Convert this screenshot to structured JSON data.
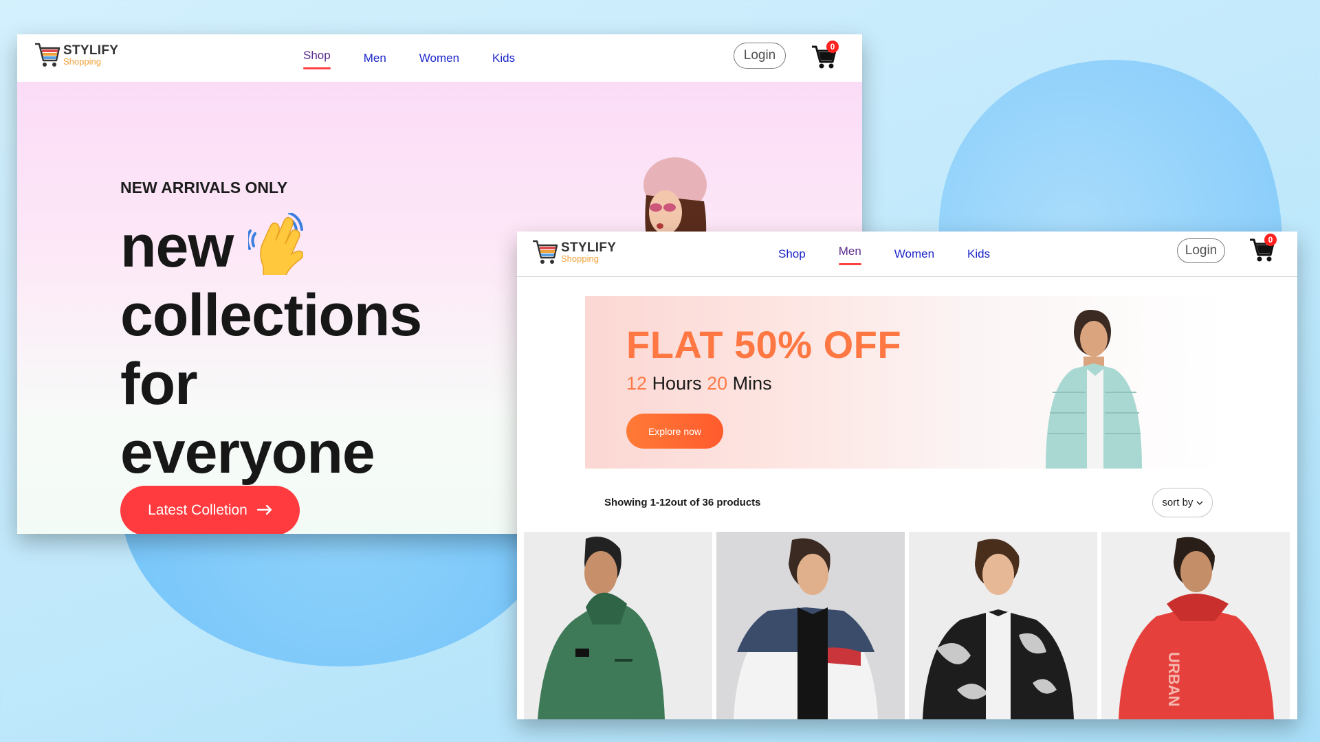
{
  "colors": {
    "accent_red": "#ff3b3f",
    "nav_link": "#1b25c9",
    "nav_active": "#5b2c8c",
    "offer_orange": "#ff7742"
  },
  "brand": {
    "name": "STYLIFY",
    "tagline": "Shopping",
    "logo_icon": "shopping-cart-icon"
  },
  "screen1": {
    "nav": {
      "items": [
        {
          "label": "Shop",
          "active": true
        },
        {
          "label": "Men",
          "active": false
        },
        {
          "label": "Women",
          "active": false
        },
        {
          "label": "Kids",
          "active": false
        }
      ],
      "login_label": "Login",
      "cart_count": "0"
    },
    "hero": {
      "eyebrow": "NEW ARRIVALS ONLY",
      "title_lines": [
        "new",
        "collections",
        "for",
        "everyone"
      ],
      "wave_icon": "waving-hand-icon",
      "cta_label": "Latest Colletion",
      "cta_icon": "arrow-right-icon"
    }
  },
  "screen2": {
    "nav": {
      "items": [
        {
          "label": "Shop",
          "active": false
        },
        {
          "label": "Men",
          "active": true
        },
        {
          "label": "Women",
          "active": false
        },
        {
          "label": "Kids",
          "active": false
        }
      ],
      "login_label": "Login",
      "cart_count": "0"
    },
    "banner": {
      "title": "FLAT 50% OFF",
      "hours": "12",
      "hours_label": "Hours",
      "mins": "20",
      "mins_label": "Mins",
      "button_label": "Explore now"
    },
    "showing_text": "Showing 1-12out of 36 products",
    "sort_label": "sort by",
    "products": [
      {
        "name": "green-hooded-jacket"
      },
      {
        "name": "colorblock-puffer-jacket"
      },
      {
        "name": "printed-bomber-jacket"
      },
      {
        "name": "red-rain-jacket"
      }
    ]
  }
}
